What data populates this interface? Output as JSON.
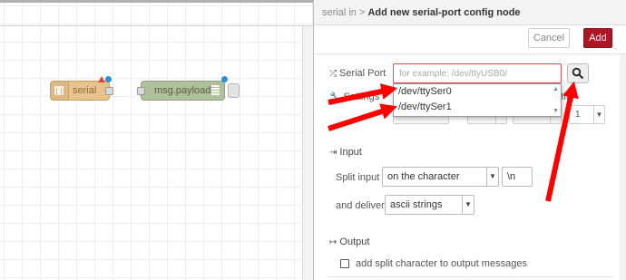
{
  "workspace": {
    "nodes": [
      {
        "label": "serial",
        "icon": "serial-port-icon"
      },
      {
        "label": "msg.payload",
        "icon": "list-icon"
      }
    ]
  },
  "panel": {
    "breadcrumb_parent": "serial in",
    "breadcrumb_separator": ">",
    "title": "Add new serial-port config node",
    "cancel_label": "Cancel",
    "add_label": "Add",
    "serial_port": {
      "label": "Serial Port",
      "placeholder": "for example: /dev/ttyUSB0/",
      "value": "",
      "options": [
        "/dev/ttySer0",
        "/dev/ttySer1"
      ]
    },
    "settings": {
      "label": "Settings",
      "stop_bits_label": "p Bits",
      "stop_bits_value": "1"
    },
    "input": {
      "section_label": "Input",
      "split_input_label": "Split input",
      "split_input_value": "on the character",
      "split_char_value": "\\n",
      "deliver_label": "and deliver",
      "deliver_value": "ascii strings"
    },
    "output": {
      "section_label": "Output",
      "add_split_char_label": "add split character to output messages",
      "add_split_char_checked": false
    }
  },
  "colors": {
    "add_button": "#ad1625",
    "serial_node": "#e8c38c",
    "debug_node": "#b0c09a",
    "annotation_arrow": "#ff0000",
    "input_error_border": "#d94c4c"
  }
}
